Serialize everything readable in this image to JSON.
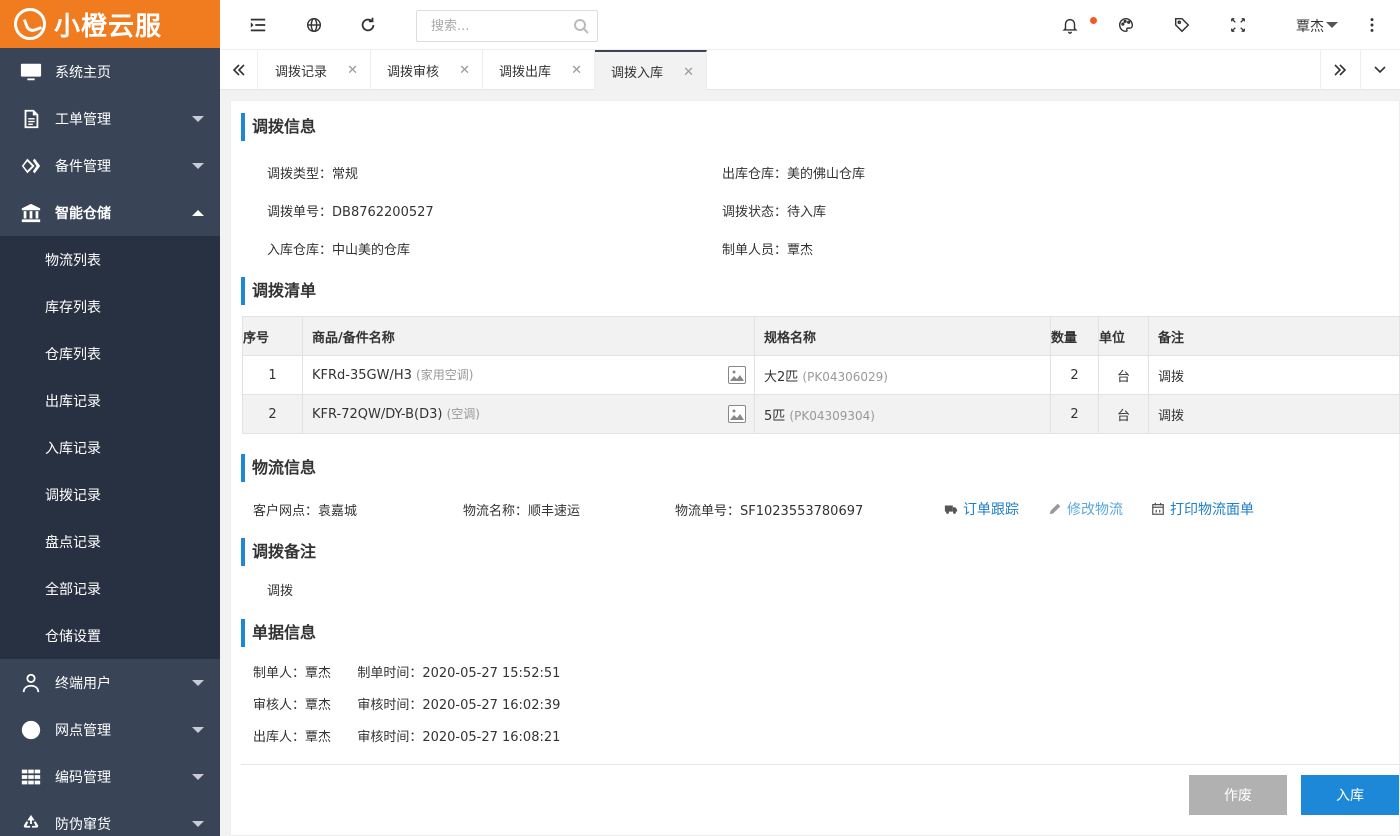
{
  "app": {
    "logo_text": "小橙云服"
  },
  "sidebar": {
    "items": [
      {
        "label": "系统主页",
        "icon": "monitor-icon",
        "has_caret": false
      },
      {
        "label": "工单管理",
        "icon": "document-icon",
        "has_caret": true
      },
      {
        "label": "备件管理",
        "icon": "diamond-link-icon",
        "has_caret": true
      },
      {
        "label": "智能仓储",
        "icon": "bank-icon",
        "has_caret": true,
        "expanded": true
      }
    ],
    "submenu": [
      "物流列表",
      "库存列表",
      "仓库列表",
      "出库记录",
      "入库记录",
      "调拨记录",
      "盘点记录",
      "全部记录",
      "仓储设置"
    ],
    "items_after": [
      {
        "label": "终端用户",
        "icon": "user-icon"
      },
      {
        "label": "网点管理",
        "icon": "globe-icon"
      },
      {
        "label": "编码管理",
        "icon": "grid-icon"
      },
      {
        "label": "防伪窜货",
        "icon": "recycle-icon"
      }
    ]
  },
  "header": {
    "search_placeholder": "搜索...",
    "user_name": "覃杰"
  },
  "tabs": [
    {
      "label": "调拨记录",
      "active": false
    },
    {
      "label": "调拨审核",
      "active": false
    },
    {
      "label": "调拨出库",
      "active": false
    },
    {
      "label": "调拨入库",
      "active": true
    }
  ],
  "transfer_info": {
    "title": "调拨信息",
    "type_label": "调拨类型：",
    "type_value": "常规",
    "out_wh_label": "出库仓库：",
    "out_wh_value": "美的佛山仓库",
    "no_label": "调拨单号：",
    "no_value": "DB8762200527",
    "status_label": "调拨状态：",
    "status_value": "待入库",
    "in_wh_label": "入库仓库：",
    "in_wh_value": "中山美的仓库",
    "maker_label": "制单人员：",
    "maker_value": "覃杰"
  },
  "transfer_list": {
    "title": "调拨清单",
    "columns": [
      "序号",
      "商品/备件名称",
      "规格名称",
      "数量",
      "单位",
      "备注"
    ],
    "rows": [
      {
        "no": "1",
        "name": "KFRd-35GW/H3",
        "name_tag": "(家用空调)",
        "spec": "大2匹",
        "spec_code": "(PK04306029)",
        "qty": "2",
        "unit": "台",
        "note": "调拨"
      },
      {
        "no": "2",
        "name": "KFR-72QW/DY-B(D3)",
        "name_tag": "(空调)",
        "spec": "5匹",
        "spec_code": "(PK04309304)",
        "qty": "2",
        "unit": "台",
        "note": "调拨"
      }
    ]
  },
  "logistics": {
    "title": "物流信息",
    "branch_label": "客户网点：",
    "branch_value": "袁嘉城",
    "company_label": "物流名称：",
    "company_value": "顺丰速运",
    "tracking_label": "物流单号：",
    "tracking_value": "SF1023553780697",
    "track_link": "订单跟踪",
    "edit_link": "修改物流",
    "print_link": "打印物流面单"
  },
  "remark": {
    "title": "调拨备注",
    "text": "调拨"
  },
  "doc_info": {
    "title": "单据信息",
    "rows": [
      {
        "who_label": "制单人：",
        "who": "覃杰",
        "time_label": "制单时间：",
        "time": "2020-05-27 15:52:51"
      },
      {
        "who_label": "审核人：",
        "who": "覃杰",
        "time_label": "审核时间：",
        "time": "2020-05-27 16:02:39"
      },
      {
        "who_label": "出库人：",
        "who": "覃杰",
        "time_label": "审核时间：",
        "time": "2020-05-27 16:08:21"
      }
    ]
  },
  "actions": {
    "void_label": "作废",
    "stock_in_label": "入库"
  },
  "colors": {
    "brand": "#f07c1f",
    "sidebar": "#394457",
    "accent": "#1e88d8"
  }
}
